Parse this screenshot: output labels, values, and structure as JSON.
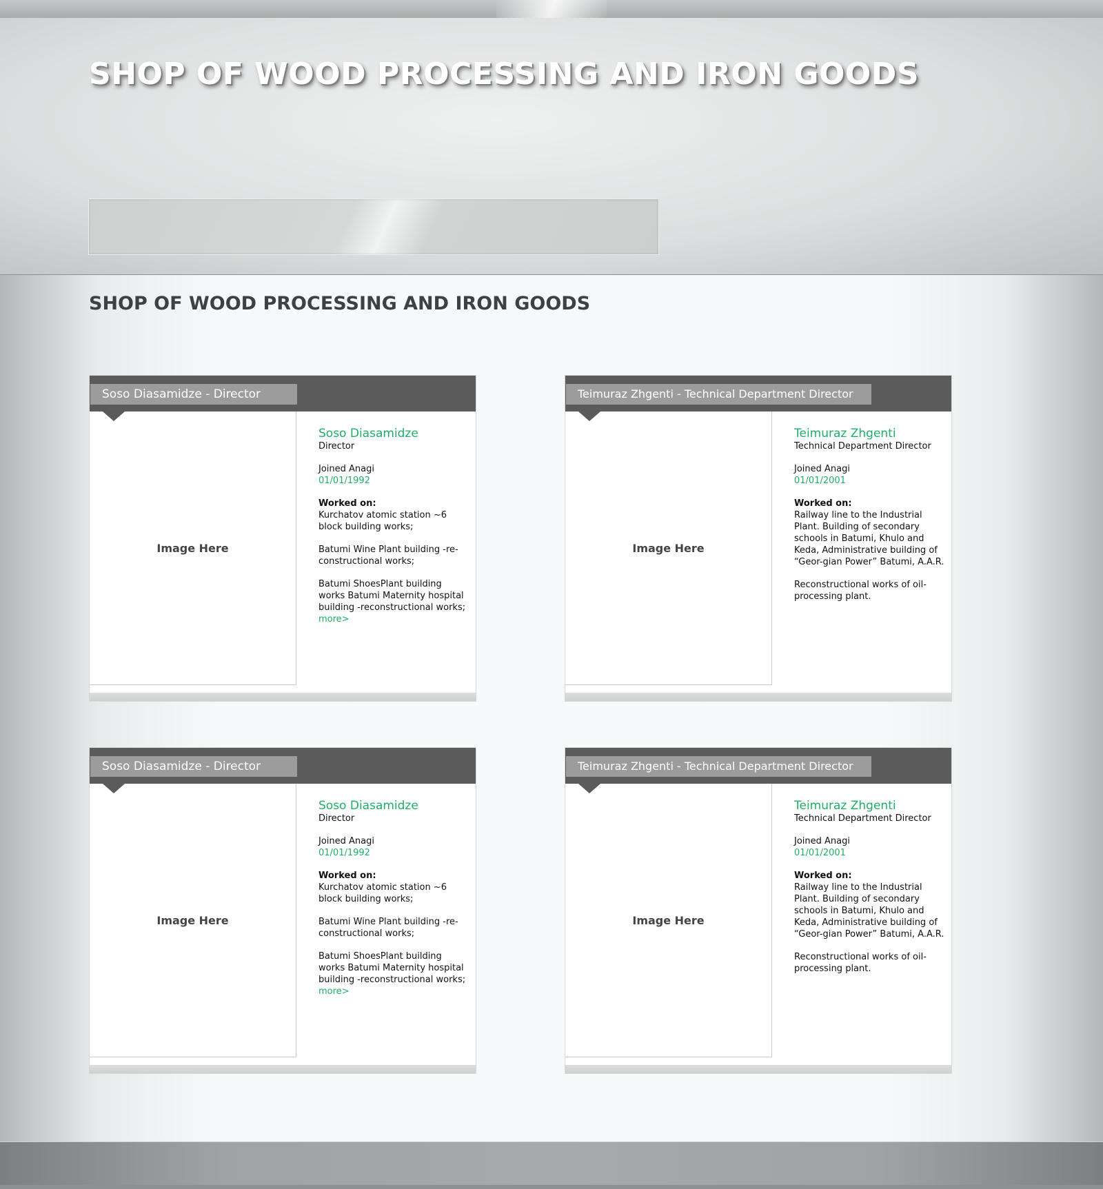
{
  "site_title": "SHOP OF WOOD PROCESSING AND IRON GOODS",
  "section_title": "SHOP OF WOOD PROCESSING AND IRON GOODS",
  "cards": [
    {
      "header": "Soso Diasamidze - Director",
      "image_label": "Image Here",
      "name": "Soso Diasamidze",
      "role": "Director",
      "joined_label": "Joined Anagi",
      "joined_date": "01/01/1992",
      "worked_label": "Worked on:",
      "works": [
        "Kurchatov atomic station ~6 block building works;",
        "Batumi Wine Plant building -re-constructional works;",
        "Batumi ShoesPlant building works Batumi Maternity hospital building -reconstructional works;"
      ],
      "more": "more>"
    },
    {
      "header": "Teimuraz Zhgenti - Technical Department Director",
      "image_label": "Image Here",
      "name": "Teimuraz Zhgenti",
      "role": "Technical Department Director",
      "joined_label": "Joined Anagi",
      "joined_date": "01/01/2001",
      "worked_label": "Worked on:",
      "works": [
        "Railway line to the Industrial Plant. Building of secondary schools in Batumi, Khulo and Keda, Administrative building of “Geor-gian Power” Batumi, A.A.R.",
        "Reconstructional works of oil-processing plant."
      ]
    },
    {
      "header": "Soso Diasamidze - Director",
      "image_label": "Image Here",
      "name": "Soso Diasamidze",
      "role": "Director",
      "joined_label": "Joined Anagi",
      "joined_date": "01/01/1992",
      "worked_label": "Worked on:",
      "works": [
        "Kurchatov atomic station ~6 block building works;",
        "Batumi Wine Plant building -re-constructional works;",
        "Batumi ShoesPlant building works Batumi Maternity hospital building -reconstructional works;"
      ],
      "more": "more>"
    },
    {
      "header": "Teimuraz Zhgenti - Technical Department Director",
      "image_label": "Image Here",
      "name": "Teimuraz Zhgenti",
      "role": "Technical Department Director",
      "joined_label": "Joined Anagi",
      "joined_date": "01/01/2001",
      "worked_label": "Worked on:",
      "works": [
        "Railway line to the Industrial Plant. Building of secondary schools in Batumi, Khulo and Keda, Administrative building of “Geor-gian Power” Batumi, A.A.R.",
        "Reconstructional works of oil-processing plant."
      ]
    }
  ]
}
